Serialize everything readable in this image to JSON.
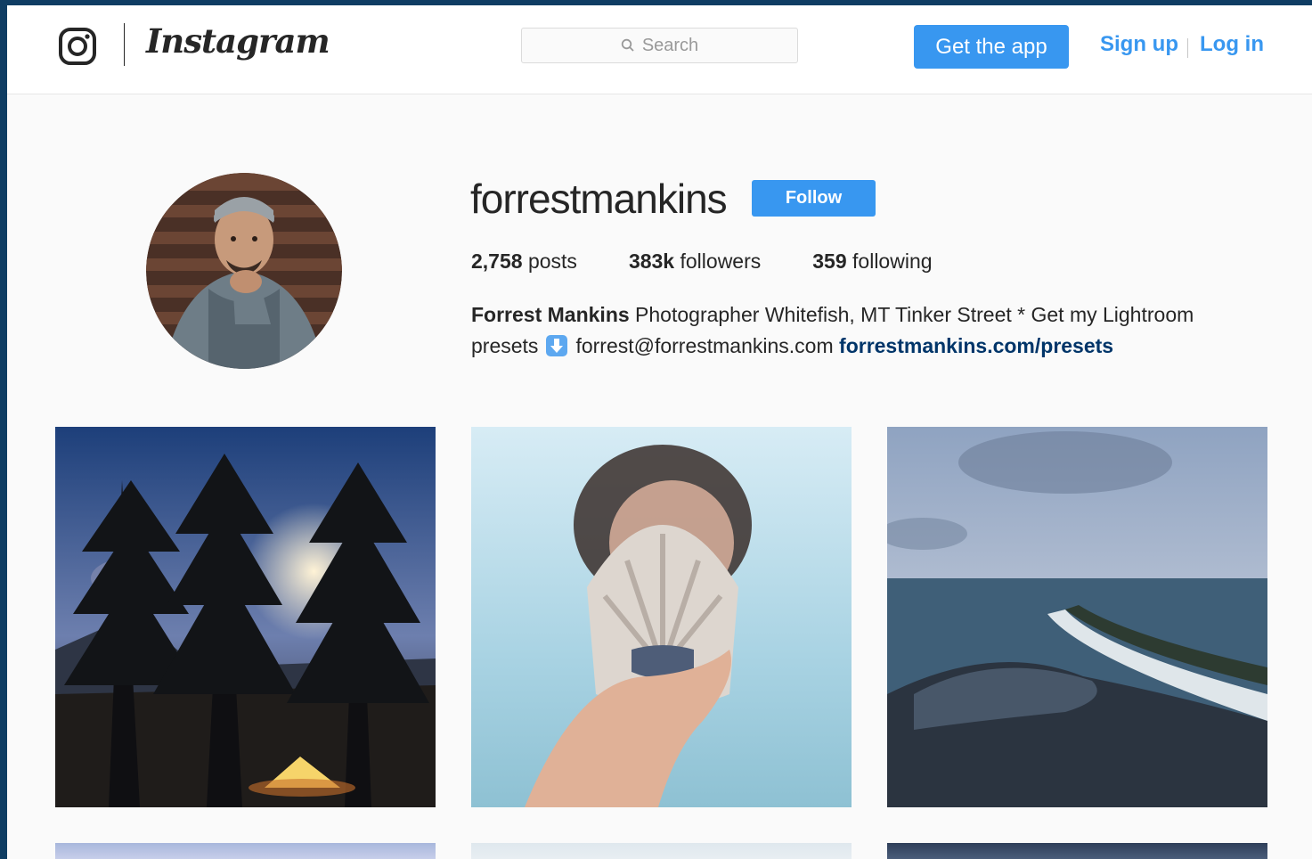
{
  "header": {
    "brand": "Instagram",
    "search_placeholder": "Search",
    "get_app_label": "Get the app",
    "signup_label": "Sign up",
    "login_label": "Log in"
  },
  "profile": {
    "username": "forrestmankins",
    "follow_label": "Follow",
    "stats": {
      "posts_count": "2,758",
      "posts_label": "posts",
      "followers_count": "383k",
      "followers_label": "followers",
      "following_count": "359",
      "following_label": "following"
    },
    "bio": {
      "full_name": "Forrest Mankins",
      "text_line": " Photographer Whitefish, MT Tinker Street * Get my Lightroom presets",
      "email": "forrest@forrestmankins.com",
      "link": "forrestmankins.com/presets"
    }
  },
  "posts": [
    {
      "icon": "campsite-night-photo"
    },
    {
      "icon": "seashell-photo"
    },
    {
      "icon": "coastline-aerial-photo"
    },
    {
      "icon": "photo-row2-1"
    },
    {
      "icon": "photo-row2-2"
    },
    {
      "icon": "photo-row2-3"
    }
  ],
  "colors": {
    "accent": "#3897f0",
    "link_dark": "#003569",
    "frame": "#0f3d63"
  }
}
